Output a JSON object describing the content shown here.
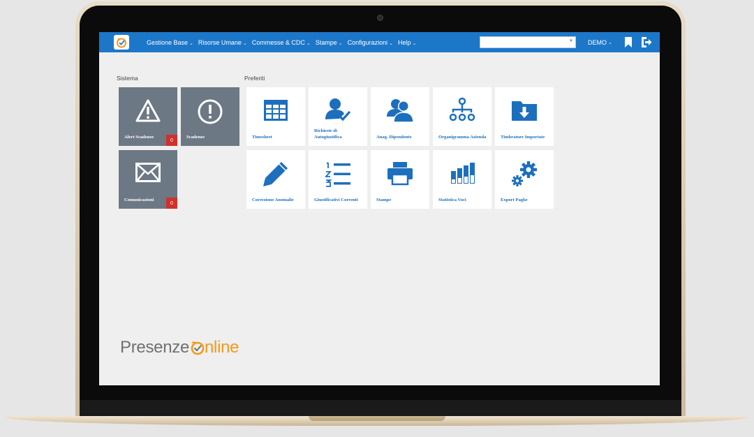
{
  "app": {
    "logo_icon": "clock-check-icon",
    "brand_part1": "Presenze ",
    "brand_part2": "nline",
    "brand_accent": "#f39a1c"
  },
  "navbar": {
    "bg_color": "#1d77c9",
    "menu": [
      {
        "label": "Gestione Base"
      },
      {
        "label": "Risorse Umane"
      },
      {
        "label": "Commesse & CDC"
      },
      {
        "label": "Stampe"
      },
      {
        "label": "Configurazioni"
      },
      {
        "label": "Help"
      }
    ],
    "search_value": "",
    "user": "DEMO",
    "bookmark_icon": "bookmark-icon",
    "logout_icon": "logout-icon"
  },
  "sistema": {
    "title": "Sistema",
    "tiles": [
      {
        "label": "Alert Scadenze",
        "icon": "warning-icon",
        "badge": "0"
      },
      {
        "label": "Scadenze",
        "icon": "exclamation-circle-icon"
      },
      {
        "label": "Comunicazioni",
        "icon": "envelope-icon",
        "badge": "0"
      }
    ]
  },
  "preferiti": {
    "title": "Preferiti",
    "tiles": [
      {
        "label": "Timesheet",
        "icon": "grid-table-icon"
      },
      {
        "label": "Richieste di Autogiustifica",
        "icon": "user-check-icon"
      },
      {
        "label": "Anag. Dipendente",
        "icon": "users-icon"
      },
      {
        "label": "Organigramma Azienda",
        "icon": "org-chart-icon"
      },
      {
        "label": "Timbrature Importate",
        "icon": "folder-download-icon"
      },
      {
        "label": "Correzione Anomalie",
        "icon": "pencil-icon"
      },
      {
        "label": "Giustificativi Correnti",
        "icon": "numbered-list-icon"
      },
      {
        "label": "Stampe",
        "icon": "printer-icon"
      },
      {
        "label": "Statistica Voci",
        "icon": "bar-chart-icon"
      },
      {
        "label": "Export Paghe",
        "icon": "gears-icon"
      }
    ]
  }
}
